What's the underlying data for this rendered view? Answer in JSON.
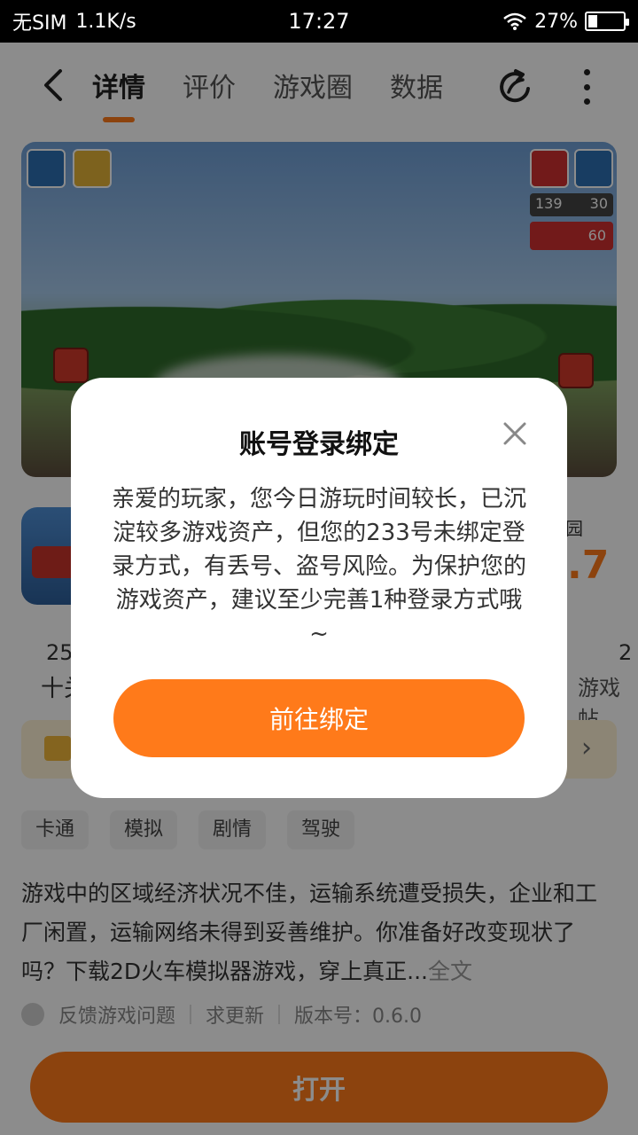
{
  "status_bar": {
    "carrier": "无SIM",
    "net_speed": "1.1K/s",
    "time": "17:27",
    "battery": "27%",
    "battery_level": 0.27
  },
  "nav": {
    "tabs": [
      {
        "label": "详情",
        "active": true
      },
      {
        "label": "评价",
        "active": false
      },
      {
        "label": "游戏圈",
        "active": false
      },
      {
        "label": "数据",
        "active": false
      }
    ],
    "icons": [
      "back-arrow-icon",
      "share-icon",
      "more-icon"
    ]
  },
  "hero": {
    "speed_readout": "139",
    "speed_limit_1": "30",
    "speed_limit_2": "60"
  },
  "app_info": {
    "developer_suffix": "乐园",
    "rating_partial": ".7",
    "stat_left_value": "25",
    "stat_left_label": "十关",
    "stat_right_value": "2",
    "stat_right_label": "游戏帖"
  },
  "tags": [
    "卡通",
    "模拟",
    "剧情",
    "驾驶"
  ],
  "description": {
    "text": "游戏中的区域经济状况不佳，运输系统遭受损失，企业和工厂闲置，运输网络未得到妥善维护。你准备好改变现状了吗？下载2D火车模拟器游戏，穿上真正...",
    "more_label": "全文"
  },
  "meta": {
    "feedback": "反馈游戏问题",
    "request_update": "求更新",
    "version": "版本号：0.6.0"
  },
  "open_button": "打开",
  "dialog": {
    "title": "账号登录绑定",
    "body": "亲爱的玩家，您今日游玩时间较长，已沉淀较多游戏资产，但您的233号未绑定登录方式，有丢号、盗号风险。为保护您的游戏资产，建议至少完善1种登录方式哦~",
    "cta": "前往绑定"
  },
  "colors": {
    "accent": "#ff7a1a",
    "overlay": "rgba(0,0,0,0.45)"
  }
}
